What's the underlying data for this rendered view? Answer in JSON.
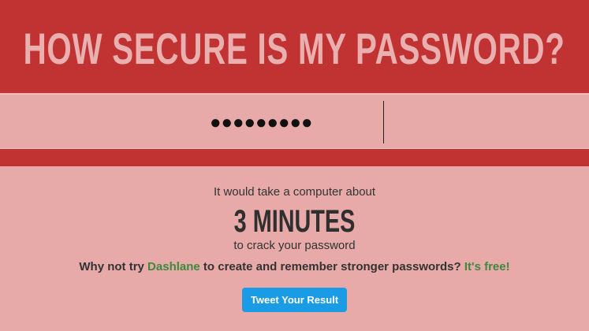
{
  "header": {
    "title": "HOW SECURE IS MY PASSWORD?"
  },
  "password_field": {
    "value": "●●●●●●●●●"
  },
  "result": {
    "lead": "It would take a computer about",
    "time": "3 MINUTES",
    "tail": "to crack your password"
  },
  "promo": {
    "prefix": "Why not try ",
    "link": "Dashlane",
    "middle": " to create and remember stronger passwords? ",
    "free": "It's free!"
  },
  "tweet_button": {
    "label": "Tweet Your Result"
  },
  "colors": {
    "header_red": "#c13333",
    "background_pink": "#e8aaa9",
    "title_pink": "#eab0b0",
    "link_green": "#3c8a3c",
    "tweet_blue": "#1a9be6"
  }
}
